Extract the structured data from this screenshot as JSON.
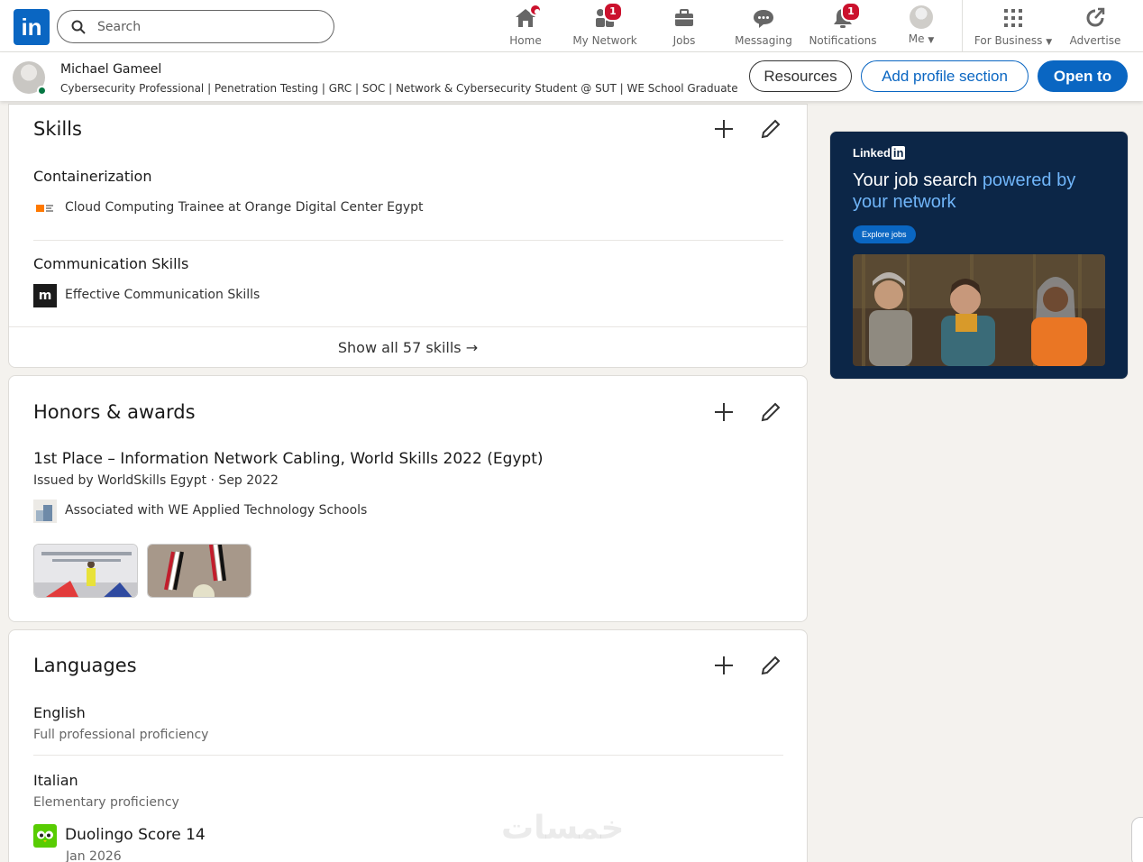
{
  "topbar": {
    "logo_text": "in",
    "search_placeholder": "Search",
    "nav": [
      {
        "label": "Home",
        "icon": "home-icon"
      },
      {
        "label": "My Network",
        "icon": "people-icon",
        "badge": "1"
      },
      {
        "label": "Jobs",
        "icon": "briefcase-icon"
      },
      {
        "label": "Messaging",
        "icon": "messaging-icon"
      },
      {
        "label": "Notifications",
        "icon": "bell-icon",
        "badge": "1"
      },
      {
        "label": "Me",
        "icon": "avatar"
      },
      {
        "label": "For Business",
        "icon": "grid-icon"
      },
      {
        "label": "Advertise",
        "icon": "advertise-icon"
      }
    ]
  },
  "profile": {
    "name": "Michael Gameel",
    "headline": "Cybersecurity Professional | Penetration Testing | GRC | SOC | Network & Cybersecurity Student @ SUT | WE School Graduate",
    "buttons": {
      "resources": "Resources",
      "add_section": "Add profile section",
      "open_to": "Open to"
    }
  },
  "skills": {
    "title": "Skills",
    "items": [
      {
        "name": "Containerization",
        "context": "Cloud Computing Trainee at Orange Digital Center Egypt"
      },
      {
        "name": "Communication Skills",
        "context": "Effective Communication Skills"
      }
    ],
    "show_all": "Show all 57 skills →"
  },
  "honors": {
    "title": "Honors & awards",
    "award_title": "1st Place – Information Network Cabling, World Skills 2022 (Egypt)",
    "issued": "Issued by WorldSkills Egypt · Sep 2022",
    "associated": "Associated with WE Applied Technology Schools"
  },
  "languages": {
    "title": "Languages",
    "items": [
      {
        "name": "English",
        "level": "Full professional proficiency"
      },
      {
        "name": "Italian",
        "level": "Elementary proficiency"
      }
    ],
    "cert_title": "Duolingo Score 14",
    "cert_date": "Jan 2026"
  },
  "ad": {
    "brand": "Linked",
    "brand_in": "in",
    "headline_plain": "Your job search ",
    "headline_highlight": "powered by your network",
    "button": "Explore jobs"
  },
  "colors": {
    "brand": "#0a66c2",
    "badge": "#cb112d",
    "ad_bg": "#0c2647"
  }
}
